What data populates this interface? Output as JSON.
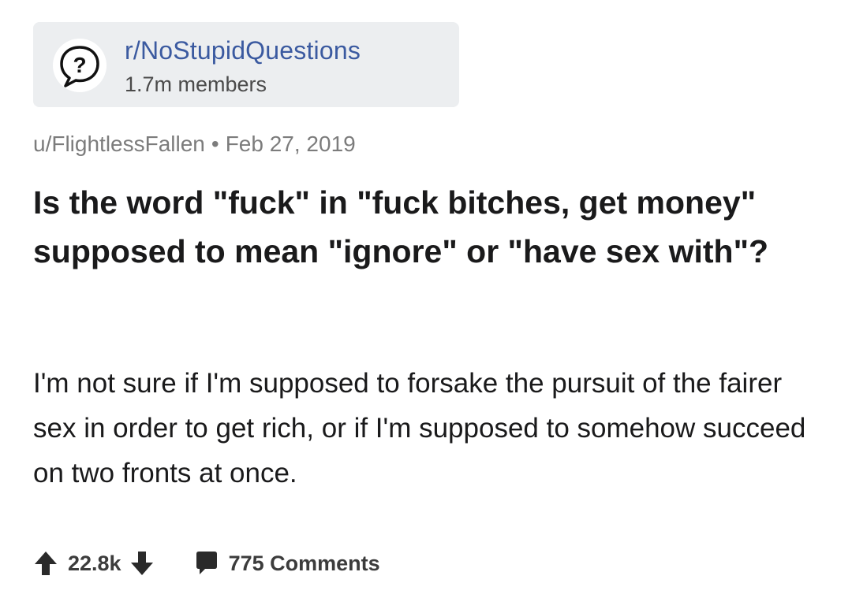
{
  "community": {
    "name": "r/NoStupidQuestions",
    "members": "1.7m members",
    "icon": "question-bubble-icon"
  },
  "post": {
    "author": "u/FlightlessFallen",
    "separator": "•",
    "date": "Feb 27, 2019",
    "title": "Is the word \"fuck\" in \"fuck bitches, get money\" supposed to mean \"ignore\" or \"have sex with\"?",
    "body": "I'm not sure if I'm supposed to forsake the pursuit of the fairer sex in order to get rich, or if I'm supposed to somehow succeed on two fronts at once."
  },
  "actions": {
    "upvote_icon": "arrow-up-icon",
    "votes": "22.8k",
    "downvote_icon": "arrow-down-icon",
    "comment_icon": "comment-bubble-icon",
    "comments": "775 Comments"
  },
  "colors": {
    "community_name": "#3b5aa0",
    "card_background": "#eceef0",
    "meta_text": "#7c7c7c"
  }
}
